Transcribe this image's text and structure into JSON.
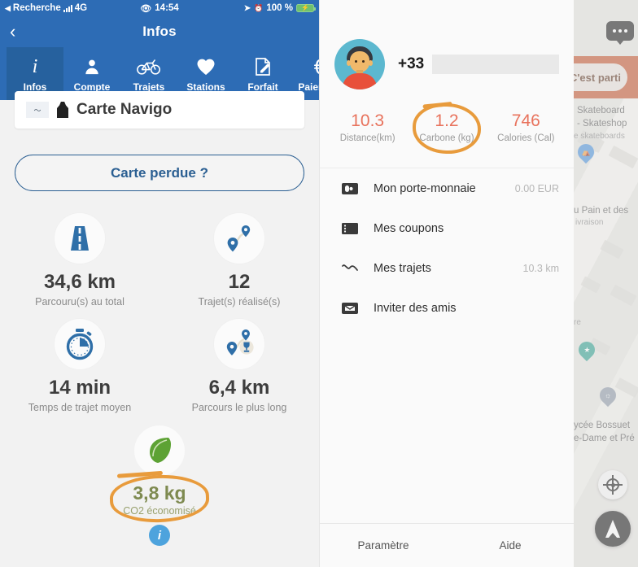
{
  "left_panel": {
    "status_bar": {
      "carrier_back": "Recherche",
      "network": "4G",
      "time": "14:54",
      "battery_percent": "100 %",
      "signal_icon": "signal-bars-icon",
      "eye_icon": "eye-icon",
      "location_icon": "location-arrow-icon",
      "alarm_icon": "alarm-clock-icon",
      "battery_icon": "battery-charging-icon"
    },
    "nav": {
      "back_icon": "chevron-left-icon",
      "title": "Infos"
    },
    "tabs": [
      {
        "label": "Infos",
        "icon": "info-italic-icon",
        "active": true
      },
      {
        "label": "Compte",
        "icon": "user-icon",
        "active": false
      },
      {
        "label": "Trajets",
        "icon": "bicycle-icon",
        "active": false
      },
      {
        "label": "Stations",
        "icon": "heart-icon",
        "active": false
      },
      {
        "label": "Forfait",
        "icon": "document-edit-icon",
        "active": false
      },
      {
        "label": "Paiement",
        "icon": "euro-icon",
        "active": false
      }
    ],
    "navigo_card": {
      "label": "Carte Navigo",
      "icon": "navigo-card-icon"
    },
    "lost_card_button": "Carte perdue ?",
    "stats": [
      {
        "value": "34,6 km",
        "label": "Parcouru(s) au total",
        "icon": "road-icon"
      },
      {
        "value": "12",
        "label": "Trajet(s) réalisé(s)",
        "icon": "route-pins-icon"
      },
      {
        "value": "14 min",
        "label": "Temps de trajet moyen",
        "icon": "stopwatch-icon"
      },
      {
        "value": "6,4 km",
        "label": "Parcours le plus long",
        "icon": "route-trophy-icon"
      }
    ],
    "co2": {
      "value": "3,8 kg",
      "label": "CO2 économisé",
      "icon": "leaf-icon",
      "info_badge": "i",
      "annotation": "orange-circle-annotation"
    }
  },
  "mid_panel": {
    "profile": {
      "avatar_icon": "user-avatar",
      "phone_prefix": "+33",
      "phone_value": ""
    },
    "stats": [
      {
        "value": "10.3",
        "label": "Distance(km)",
        "highlighted": false
      },
      {
        "value": "1.2",
        "label": "Carbone (kg)",
        "highlighted": true
      },
      {
        "value": "746",
        "label": "Calories (Cal)",
        "highlighted": false
      }
    ],
    "list": [
      {
        "label": "Mon porte-monnaie",
        "value": "0.00 EUR",
        "icon": "wallet-icon"
      },
      {
        "label": "Mes coupons",
        "value": "",
        "icon": "coupon-icon"
      },
      {
        "label": "Mes trajets",
        "value": "10.3 km",
        "icon": "route-squiggle-icon"
      },
      {
        "label": "Inviter des amis",
        "value": "",
        "icon": "envelope-icon"
      }
    ],
    "footer": [
      {
        "label": "Paramètre"
      },
      {
        "label": "Aide"
      }
    ]
  },
  "right_panel": {
    "chat_icon": "chat-bubble-icon",
    "cta_button": "C'est parti",
    "labels": [
      "Skateboard",
      "- Skateshop",
      "e skateboards",
      "u Pain et des",
      "ivraison",
      "re",
      "ycée Bossuet",
      "e-Dame et Pré"
    ],
    "pins": [
      {
        "icon": "store-pin-icon",
        "color": "#4a90d9"
      },
      {
        "icon": "shop-pin-icon",
        "color": "#2e9e8f"
      },
      {
        "icon": "school-pin-icon",
        "color": "#7f8b99"
      }
    ],
    "locate_button_icon": "locate-target-icon",
    "navigate_button_icon": "navigation-arrow-icon"
  },
  "colors": {
    "brand_blue": "#2d6cb5",
    "tab_active": "#26619e",
    "accent_orange": "#e89b3c",
    "stat_salmon": "#e8725c",
    "co2_green": "#7e8a50",
    "banner_red": "#c4552e"
  }
}
